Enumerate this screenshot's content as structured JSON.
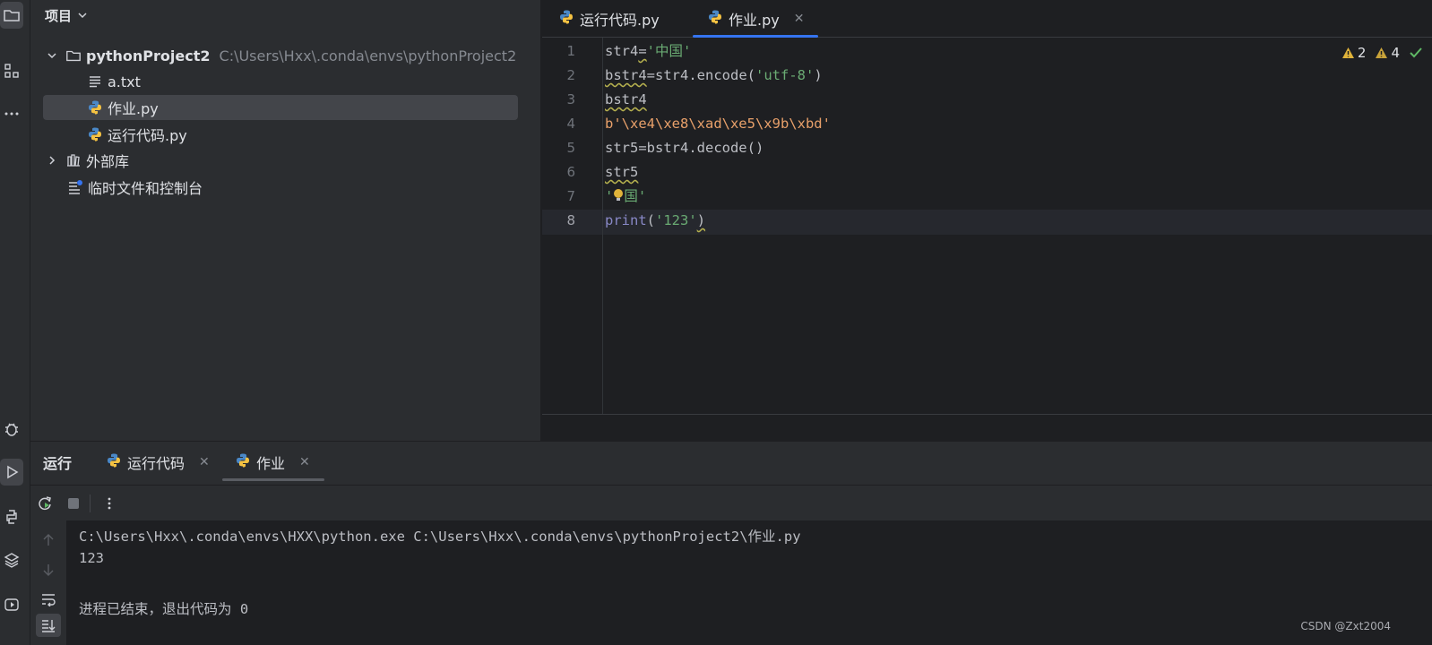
{
  "project_panel": {
    "title": "项目",
    "tree": [
      {
        "label": "pythonProject2",
        "hint": "C:\\Users\\Hxx\\.conda\\envs\\pythonProject2"
      },
      {
        "label": "a.txt"
      },
      {
        "label": "作业.py"
      },
      {
        "label": "运行代码.py"
      },
      {
        "label": "外部库"
      },
      {
        "label": "临时文件和控制台"
      }
    ]
  },
  "editor": {
    "tabs": [
      {
        "label": "运行代码.py"
      },
      {
        "label": "作业.py"
      }
    ],
    "inspections": {
      "warnings_a": "2",
      "warnings_b": "4"
    },
    "line_numbers": [
      "1",
      "2",
      "3",
      "4",
      "5",
      "6",
      "7",
      "8"
    ],
    "lines": {
      "l1_a": "str4",
      "l1_b": "=",
      "l1_c": "'中国'",
      "l2_a": "bstr4",
      "l2_b": "=str4.encode(",
      "l2_c": "'utf-8'",
      "l2_d": ")",
      "l3_a": "bstr4",
      "l4_a": "b'\\xe4\\xe8\\xad\\xe5\\x9b\\xbd'",
      "l5_a": "str5=bstr4.decode()",
      "l6_a": "str5",
      "l7_a": "'",
      "l7_b": "国'",
      "l8_a": "print",
      "l8_b": "(",
      "l8_c": "'123'",
      "l8_d": ")"
    }
  },
  "run_panel": {
    "title": "运行",
    "tabs": [
      {
        "label": "运行代码"
      },
      {
        "label": "作业"
      }
    ],
    "console": [
      "C:\\Users\\Hxx\\.conda\\envs\\HXX\\python.exe C:\\Users\\Hxx\\.conda\\envs\\pythonProject2\\作业.py",
      "123",
      "进程已结束，退出代码为 0"
    ]
  },
  "watermark": "CSDN @Zxt2004",
  "colors": {
    "accent": "#3574f0",
    "string": "#6aab73",
    "bytes": "#e8a06a",
    "builtin": "#8888c6",
    "warning": "#e0b33a"
  }
}
